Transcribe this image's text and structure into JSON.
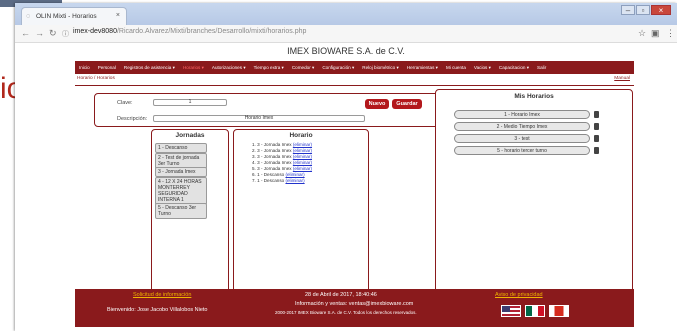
{
  "background": {
    "text": "ios."
  },
  "browser": {
    "tab_title": "OLIN Mixti - Horarios",
    "tab_close": "×",
    "url_host": "imex-dev8080",
    "url_path": "/Ricardo.Alvarez/Mixti/branches/Desarrollo/mixti/horarios.php"
  },
  "page": {
    "title": "IMEX BIOWARE S.A. de C.V.",
    "menu": [
      "Inicio",
      "Personal",
      "Registros de asistencia ▾",
      "Horarios ▾",
      "Autorizaciones ▾",
      "Tiempo extra ▾",
      "Comedor ▾",
      "Configuración ▾",
      "Reloj biométrico ▾",
      "Herramientas ▾",
      "Mi cuenta",
      "Vacios ▾",
      "Capacitacion ▾",
      "Salir"
    ],
    "breadcrumb": "Horario / Horarios",
    "manual": "Manual"
  },
  "form": {
    "clave_label": "Clave:",
    "clave_value": "1",
    "descripcion_label": "Descripción:",
    "descripcion_value": "Horario Imex",
    "nuevo": "Nuevo",
    "guardar": "Guardar"
  },
  "jornadas": {
    "title": "Jornadas",
    "items": [
      "1 - Descanso",
      "2 - Test de jornada 3er Turno",
      "3 - Jornada Imex",
      "4 - 12 X 24 HORAS MONTERREY SEGURIDAD INTERNA 1",
      "5 - Descanso 3er Turno"
    ]
  },
  "horario": {
    "title": "Horario",
    "lines": [
      {
        "text": "1. 3 - Jornada Imex",
        "link": "(eliminar)"
      },
      {
        "text": "2. 3 - Jornada Imex",
        "link": "(eliminar)"
      },
      {
        "text": "3. 3 - Jornada Imex",
        "link": "(eliminar)"
      },
      {
        "text": "4. 3 - Jornada Imex",
        "link": "(eliminar)"
      },
      {
        "text": "5. 3 - Jornada Imex",
        "link": "(eliminar)"
      },
      {
        "text": "6. 1 - Descanso",
        "link": "(eliminar)"
      },
      {
        "text": "7. 1 - Descanso",
        "link": "(eliminar)"
      }
    ]
  },
  "mis_horarios": {
    "title": "Mis Horarios",
    "items": [
      "1 - Horario Imex",
      "2 - Medio Tiempo Imex",
      "3 - test",
      "5 - horario tercer turno"
    ]
  },
  "footer": {
    "solicitud": "Solicitud de información",
    "bienvenido": "Bienvenido: Jose Jacobo Villalobos Nieto",
    "fecha": "28 de Abril de 2017, 18:40:46",
    "info": "Información y ventas: ventas@imexbioware.com",
    "copyright": "2000-2017 IMEX Bioware S.A. de C.V. Todos los derechos reservados.",
    "aviso": "Aviso de privacidad"
  },
  "colors": {
    "brand": "#8a1a1c",
    "button": "#b3181c",
    "link": "#2233cc"
  }
}
